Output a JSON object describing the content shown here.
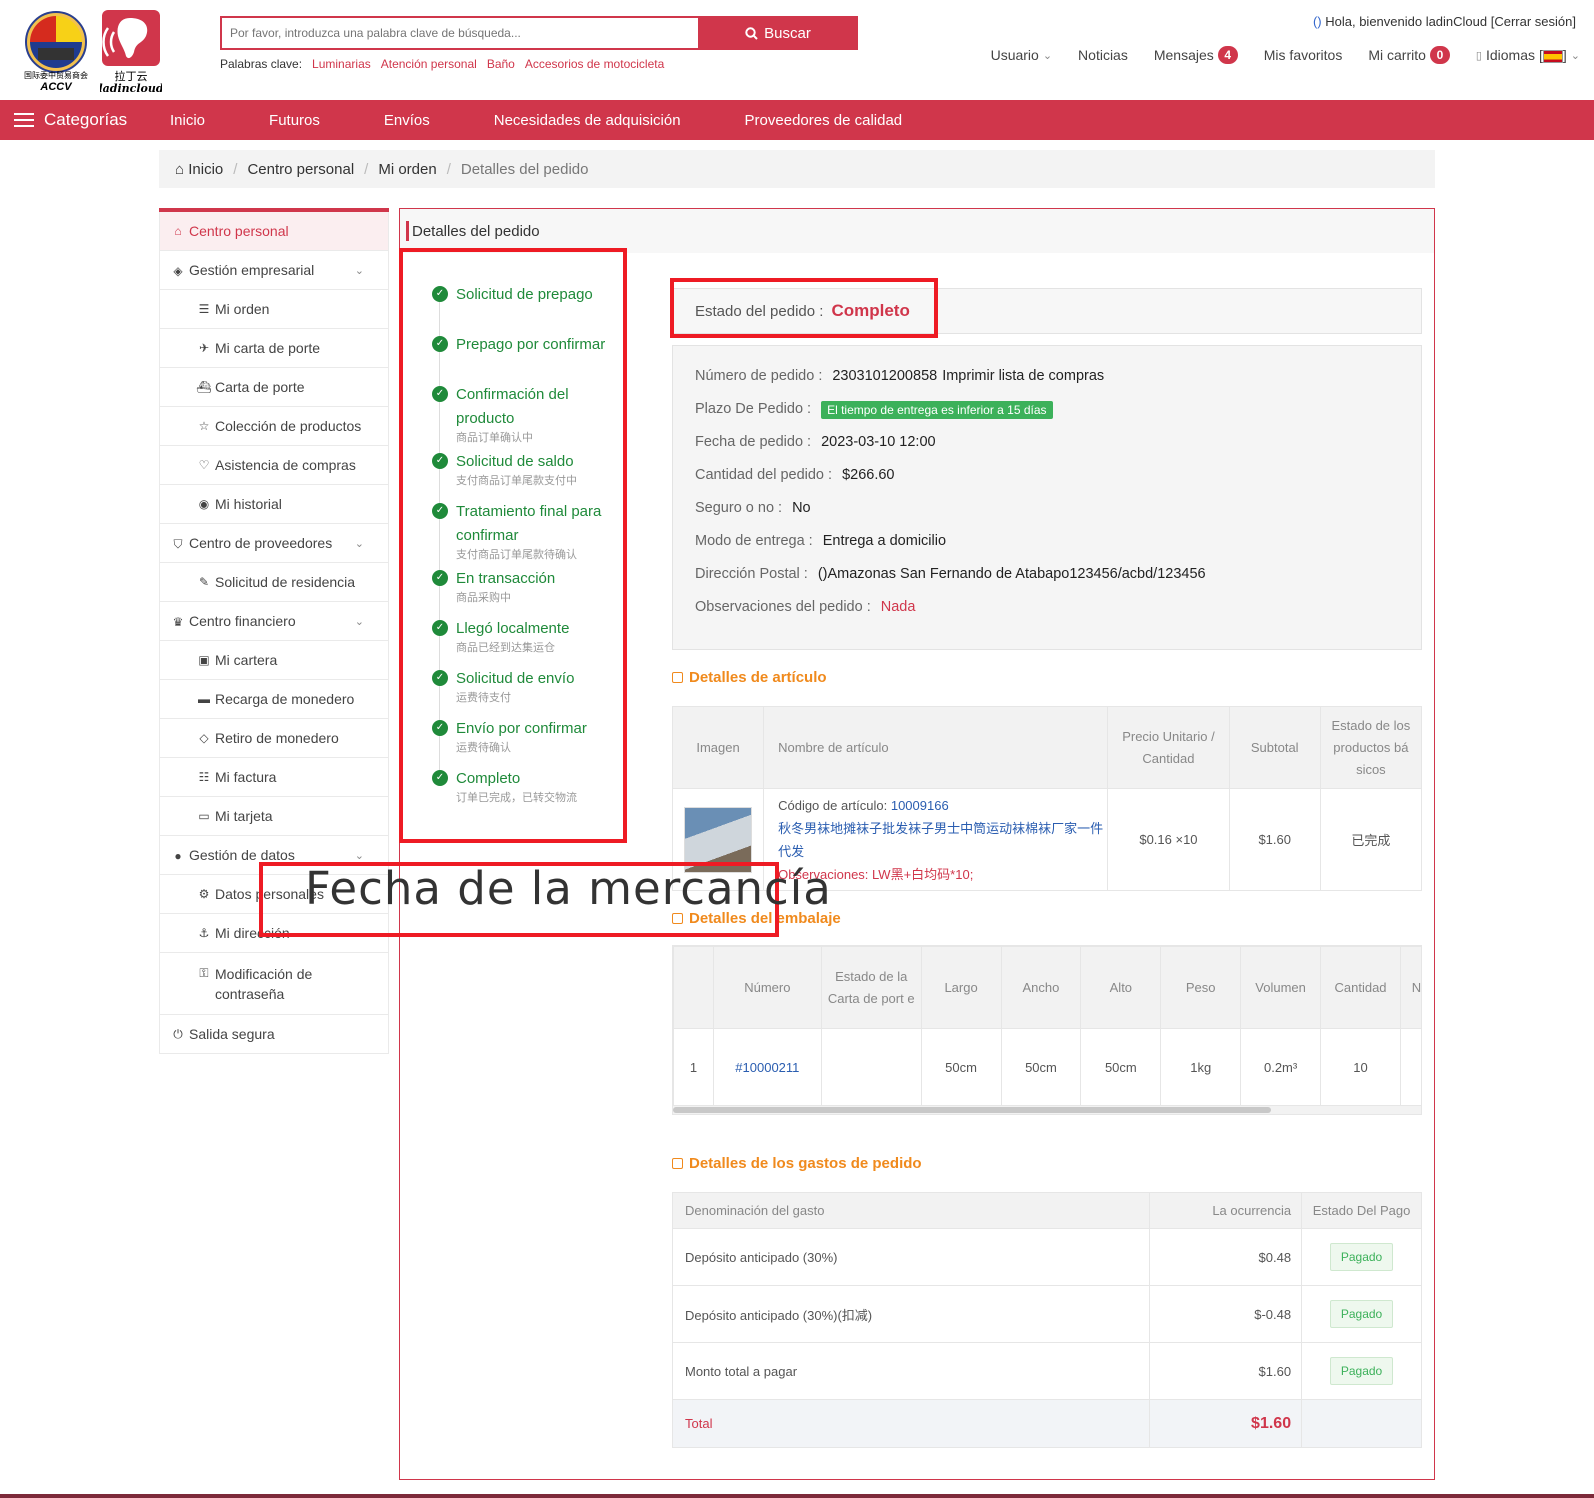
{
  "header": {
    "logo_accv_text": "ACCV",
    "logo_accv_caption": "国际委中贸易商会",
    "logo_ladin_text": "ladincloud",
    "logo_ladin_caption": "拉丁云",
    "search_placeholder": "Por favor, introduzca una palabra clave de búsqueda...",
    "search_button": "Buscar",
    "keywords_label": "Palabras clave:",
    "keywords": [
      "Luminarias",
      "Atención personal",
      "Baño",
      "Accesorios de motocicleta"
    ],
    "welcome_prefix": "()",
    "welcome": "Hola, bienvenido ladinCloud",
    "logout": "[Cerrar sesión]",
    "top_nav": {
      "user": "Usuario",
      "news": "Noticias",
      "messages": "Mensajes",
      "messages_count": "4",
      "favorites": "Mis favoritos",
      "cart": "Mi carrito",
      "cart_count": "0",
      "languages": "Idiomas"
    }
  },
  "main_nav": {
    "categories": "Categorías",
    "items": [
      "Inicio",
      "Futuros",
      "Envíos",
      "Necesidades de adquisición",
      "Proveedores de calidad"
    ]
  },
  "breadcrumb": [
    "Inicio",
    "Centro personal",
    "Mi orden",
    "Detalles del pedido"
  ],
  "sidebar": {
    "personal_center": "Centro personal",
    "business": "Gestión empresarial",
    "my_order": "Mi orden",
    "my_waybill": "Mi carta de porte",
    "waybill": "Carta de porte",
    "collection": "Colección de productos",
    "shopping_help": "Asistencia de compras",
    "history": "Mi historial",
    "suppliers": "Centro de proveedores",
    "residency": "Solicitud de residencia",
    "financial": "Centro financiero",
    "wallet": "Mi cartera",
    "recharge": "Recarga de monedero",
    "withdraw": "Retiro de monedero",
    "invoice": "Mi factura",
    "card": "Mi tarjeta",
    "data_mgmt": "Gestión de datos",
    "personal_data": "Datos personales",
    "address": "Mi dirección",
    "password": "Modificación de contraseña",
    "logout": "Salida segura"
  },
  "panel_title": "Detalles del pedido",
  "steps": [
    {
      "label": "Solicitud de prepago",
      "sub": ""
    },
    {
      "label": "Prepago por confirmar",
      "sub": ""
    },
    {
      "label": "Confirmación del producto",
      "sub": "商品订单确认中"
    },
    {
      "label": "Solicitud de saldo",
      "sub": "支付商品订单尾款支付中"
    },
    {
      "label": "Tratamiento final para confirmar",
      "sub": "支付商品订单尾款待确认"
    },
    {
      "label": "En transacción",
      "sub": "商品采购中"
    },
    {
      "label": "Llegó localmente",
      "sub": "商品已经到达集运仓"
    },
    {
      "label": "Solicitud de envío",
      "sub": "运费待支付"
    },
    {
      "label": "Envío por confirmar",
      "sub": "运费待确认"
    },
    {
      "label": "Completo",
      "sub": "订单已完成，已转交物流"
    }
  ],
  "order_status": {
    "label": "Estado del pedido :",
    "value": "Completo"
  },
  "order_info": {
    "number_label": "Número de pedido :",
    "number": "2303101200858",
    "print": "Imprimir lista de compras",
    "term_label": "Plazo De Pedido :",
    "term": "El tiempo de entrega es inferior a 15 días",
    "date_label": "Fecha de pedido :",
    "date": "2023-03-10 12:00",
    "amount_label": "Cantidad del pedido :",
    "amount": "$266.60",
    "insurance_label": "Seguro o no :",
    "insurance": "No",
    "delivery_label": "Modo de entrega :",
    "delivery": "Entrega a domicilio",
    "address_label": "Dirección Postal :",
    "address": "()Amazonas San Fernando de Atabapo123456/acbd/123456",
    "notes_label": "Observaciones del pedido :",
    "notes": "Nada"
  },
  "items_section": {
    "title": "Detalles de artículo",
    "headers": [
      "Imagen",
      "Nombre de artículo",
      "Precio Unitario / Cantidad",
      "Subtotal",
      "Estado de los productos bá sicos"
    ],
    "row": {
      "code_label": "Código de artículo:",
      "code": "10009166",
      "name": "秋冬男袜地摊袜子批发袜子男士中筒运动袜棉袜厂家一件代发",
      "notes_label": "Observaciones:",
      "notes": "LW黑+白均码*10;",
      "price_qty": "$0.16 ×10",
      "subtotal": "$1.60",
      "status": "已完成"
    }
  },
  "overlay_text": "Fecha de la mercancía",
  "packing_section": {
    "title": "Detalles del embalaje",
    "headers": [
      "",
      "Número",
      "Estado de la Carta de port e",
      "Largo",
      "Ancho",
      "Alto",
      "Peso",
      "Volumen",
      "Cantidad",
      "N"
    ],
    "row": [
      "1",
      "#10000211",
      "",
      "50cm",
      "50cm",
      "50cm",
      "1kg",
      "0.2m³",
      "10",
      ""
    ]
  },
  "fees_section": {
    "title": "Detalles de los gastos de pedido",
    "headers": [
      "Denominación del gasto",
      "La ocurrencia",
      "Estado Del Pago"
    ],
    "rows": [
      {
        "name": "Depósito anticipado (30%)",
        "amount": "$0.48",
        "status": "Pagado"
      },
      {
        "name": "Depósito anticipado (30%)(扣减)",
        "amount": "$-0.48",
        "status": "Pagado"
      },
      {
        "name": "Monto total a pagar",
        "amount": "$1.60",
        "status": "Pagado"
      }
    ],
    "total_label": "Total",
    "total": "$1.60"
  },
  "colors": {
    "brand": "#d0364b",
    "success": "#1f8a3a",
    "section": "#f08a1d",
    "annotation": "#ee1b24"
  }
}
